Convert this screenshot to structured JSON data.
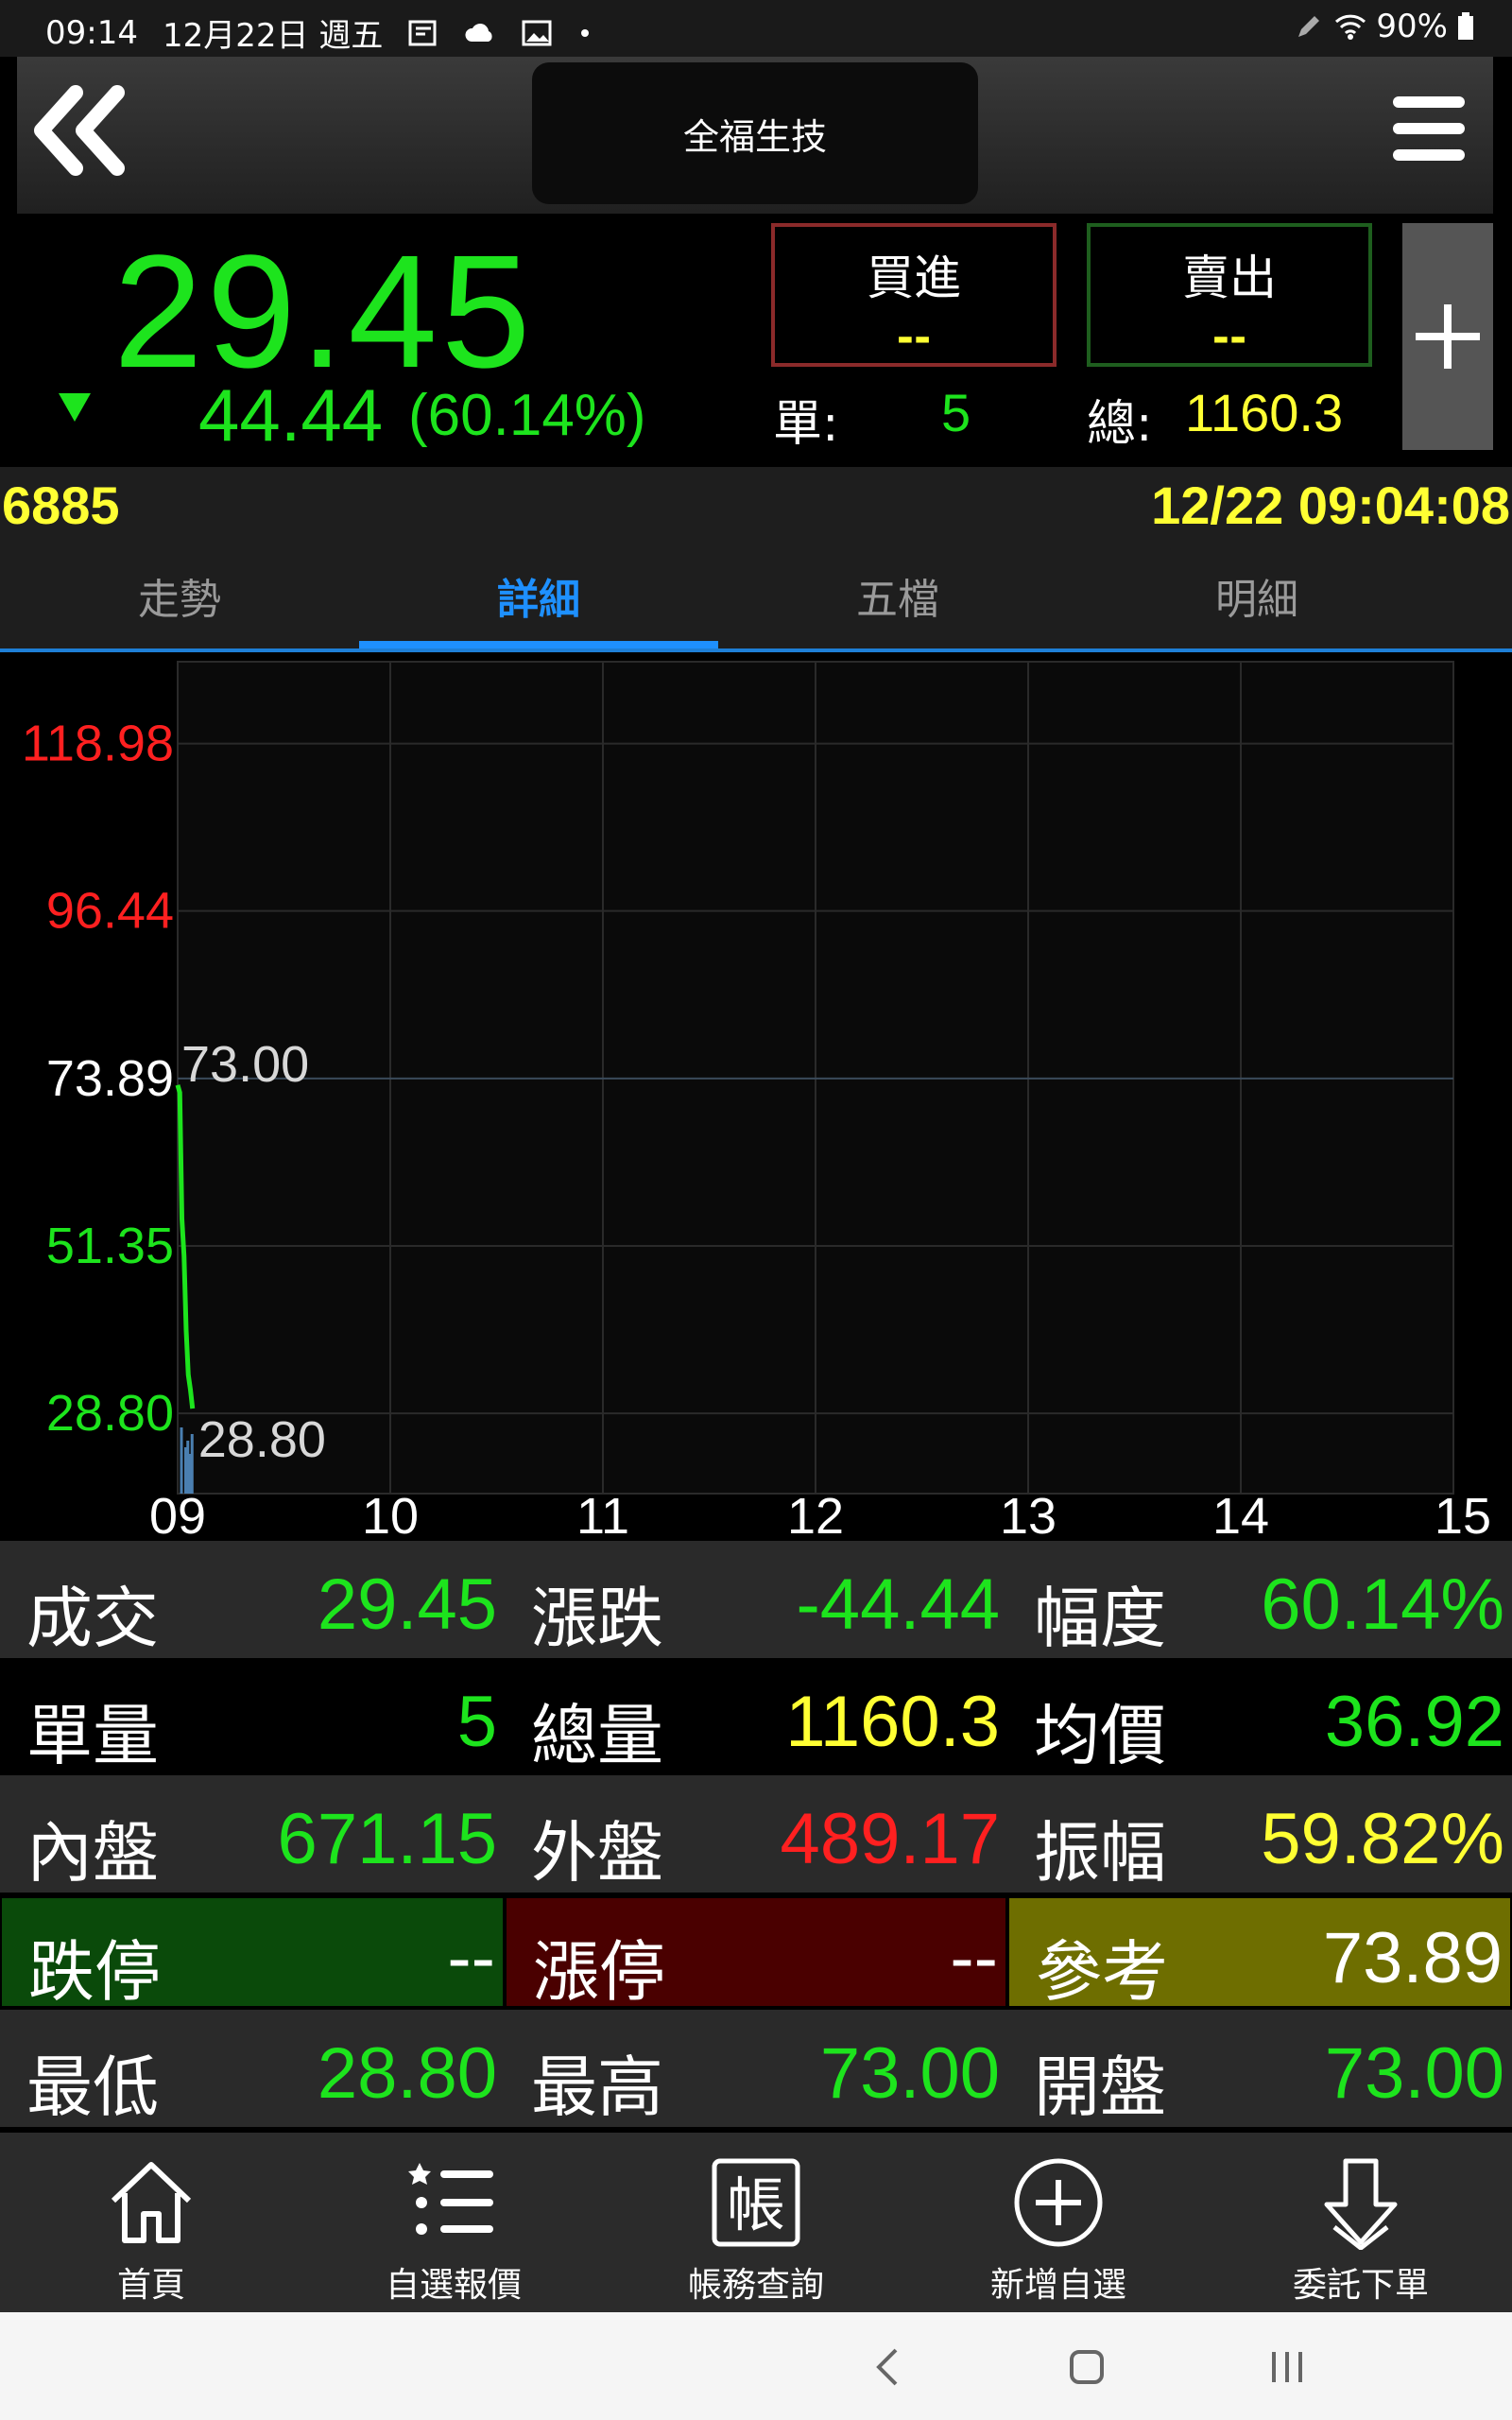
{
  "status_bar": {
    "time": "09:14",
    "date": "12月22日 週五",
    "battery": "90%"
  },
  "header": {
    "title": "全福生技"
  },
  "quote": {
    "price": "29.45",
    "change": "44.44",
    "change_pct": "(60.14%)",
    "buy_label": "買進",
    "buy_value": "--",
    "sell_label": "賣出",
    "sell_value": "--",
    "single_label": "單:",
    "single_value": "5",
    "total_label": "總:",
    "total_value": "1160.3"
  },
  "info": {
    "code": "6885",
    "time": "12/22 09:04:08"
  },
  "tabs": [
    {
      "label": "走勢",
      "active": false
    },
    {
      "label": "詳細",
      "active": true
    },
    {
      "label": "五檔",
      "active": false
    },
    {
      "label": "明細",
      "active": false
    }
  ],
  "chart_data": {
    "type": "line",
    "y_ticks": [
      {
        "value": 118.98,
        "label": "118.98",
        "color": "#ff2020"
      },
      {
        "value": 96.44,
        "label": "96.44",
        "color": "#ff2020"
      },
      {
        "value": 73.89,
        "label": "73.89",
        "color": "#ffffff"
      },
      {
        "value": 51.35,
        "label": "51.35",
        "color": "#1de41d"
      },
      {
        "value": 28.8,
        "label": "28.80",
        "color": "#1de41d"
      }
    ],
    "x_ticks": [
      "09",
      "10",
      "11",
      "12",
      "13",
      "14",
      "15"
    ],
    "ylim": [
      18,
      130
    ],
    "xlim": [
      9,
      15
    ],
    "high_label": "73.00",
    "low_label": "28.80",
    "series": [
      {
        "x": [
          9.0,
          9.01,
          9.02,
          9.03,
          9.04,
          9.05,
          9.06,
          9.07
        ],
        "y": [
          73.0,
          72.0,
          55.0,
          50.0,
          40.0,
          34.0,
          32.0,
          29.45
        ]
      }
    ],
    "volume": {
      "x": [
        9.02,
        9.04,
        9.05,
        9.06,
        9.07
      ],
      "v": [
        1.0,
        0.7,
        0.8,
        0.6,
        0.9
      ]
    }
  },
  "detail": {
    "rows": [
      [
        {
          "k": "成交",
          "v": "29.45",
          "vc": "g"
        },
        {
          "k": "漲跌",
          "v": "-44.44",
          "vc": "g"
        },
        {
          "k": "幅度",
          "v": "60.14%",
          "vc": "g"
        }
      ],
      [
        {
          "k": "單量",
          "v": "5",
          "vc": "g"
        },
        {
          "k": "總量",
          "v": "1160.3",
          "vc": "y"
        },
        {
          "k": "均價",
          "v": "36.92",
          "vc": "g"
        }
      ],
      [
        {
          "k": "內盤",
          "v": "671.15",
          "vc": "g"
        },
        {
          "k": "外盤",
          "v": "489.17",
          "vc": "r"
        },
        {
          "k": "振幅",
          "v": "59.82%",
          "vc": "y"
        }
      ],
      [
        {
          "k": "跌停",
          "v": "--",
          "vc": "w"
        },
        {
          "k": "漲停",
          "v": "--",
          "vc": "w"
        },
        {
          "k": "參考",
          "v": "73.89",
          "vc": "w"
        }
      ],
      [
        {
          "k": "最低",
          "v": "28.80",
          "vc": "g"
        },
        {
          "k": "最高",
          "v": "73.00",
          "vc": "g"
        },
        {
          "k": "開盤",
          "v": "73.00",
          "vc": "g"
        }
      ]
    ]
  },
  "bottom_nav": [
    {
      "label": "首頁",
      "icon": "home-icon"
    },
    {
      "label": "自選報價",
      "icon": "watchlist-icon"
    },
    {
      "label": "帳務查詢",
      "icon": "account-icon",
      "glyph": "帳"
    },
    {
      "label": "新增自選",
      "icon": "add-circle-icon"
    },
    {
      "label": "委託下單",
      "icon": "order-icon"
    }
  ]
}
